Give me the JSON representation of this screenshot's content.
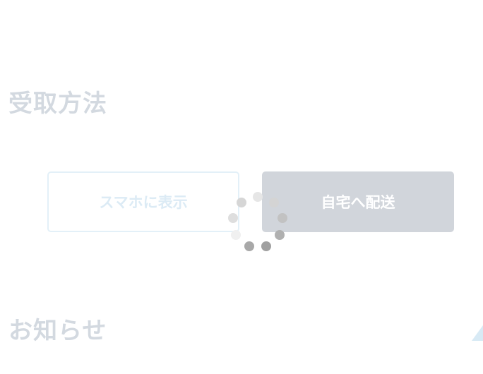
{
  "receive_section": {
    "heading": "受取方法",
    "options": [
      {
        "label": "スマホに表示",
        "selected": false
      },
      {
        "label": "自宅へ配送",
        "selected": true
      }
    ]
  },
  "loading_spinner": {
    "icon": "loading-spinner-icon",
    "dot_colors": [
      "#e6e6e6",
      "#d4d4d4",
      "#c2c2c2",
      "#b0b0b0",
      "#a0a0a0",
      "#a8a8a8",
      "#f0f0f0",
      "#dedede",
      "#d6d6d6"
    ]
  },
  "notice_section": {
    "heading": "お知らせ"
  },
  "colors": {
    "heading": "#d3d9e0",
    "selected_button_bg": "#d1d5db",
    "unselected_button_border": "#e3f0f8",
    "accent_triangle": "#d8eaf5"
  }
}
